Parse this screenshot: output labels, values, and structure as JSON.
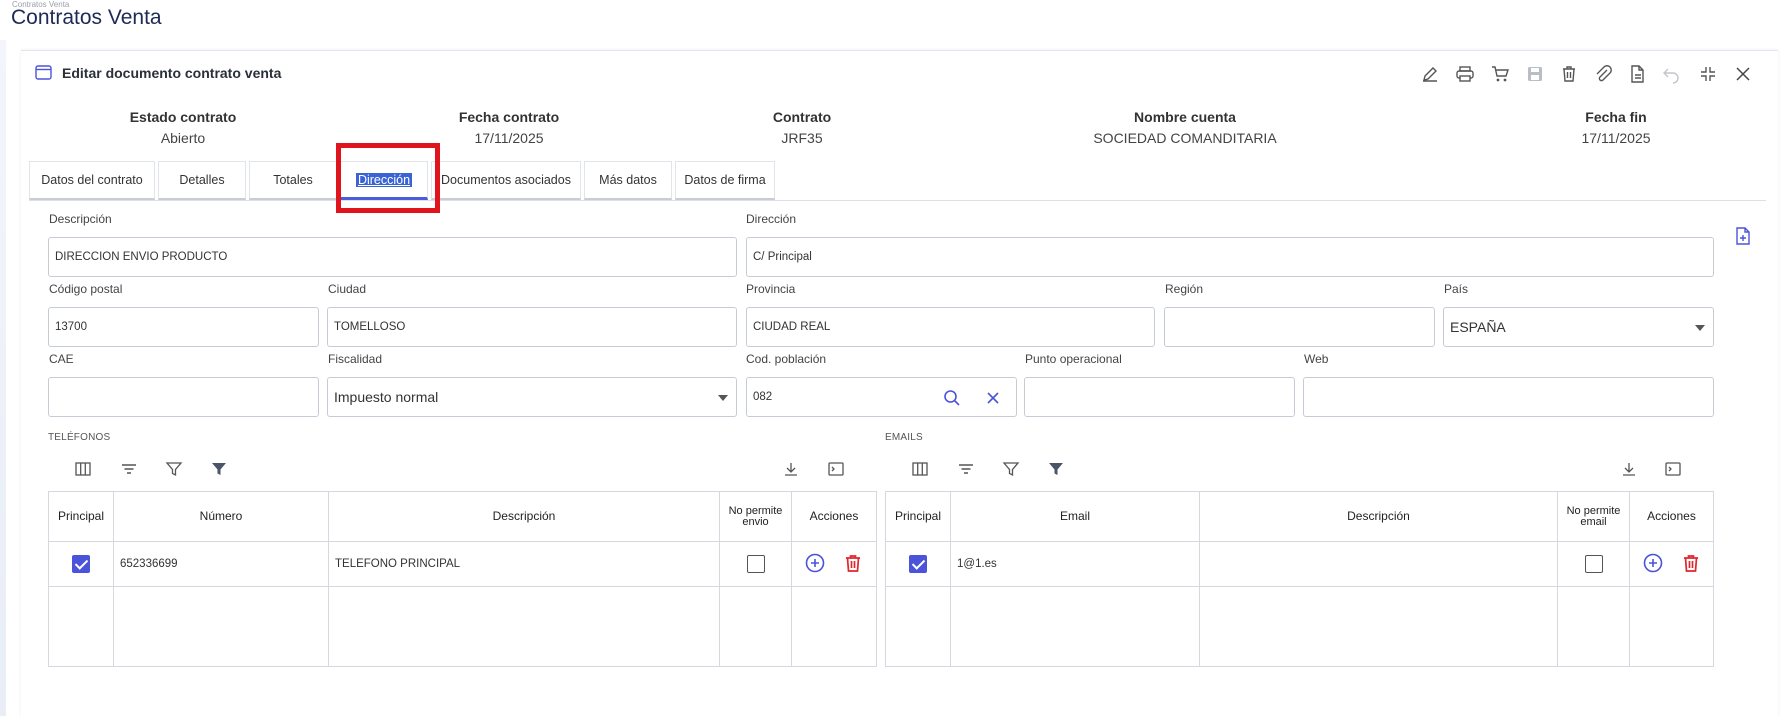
{
  "breadcrumb": "Contratos Venta",
  "app_title": "Contratos Venta",
  "panel": {
    "title": "Editar documento contrato venta",
    "toolbar": [
      "edit-icon",
      "print-icon",
      "cart-icon",
      "save-icon",
      "trash-icon",
      "attach-icon",
      "document-icon",
      "undo-icon",
      "collapse-icon",
      "close-icon"
    ]
  },
  "summary": [
    {
      "label": "Estado contrato",
      "value": "Abierto"
    },
    {
      "label": "Fecha contrato",
      "value": "17/11/2025"
    },
    {
      "label": "Contrato",
      "value": "JRF35"
    },
    {
      "label": "Nombre cuenta",
      "value": "SOCIEDAD COMANDITARIA"
    },
    {
      "label": "Fecha fin",
      "value": "17/11/2025"
    }
  ],
  "tabs": [
    "Datos del contrato",
    "Detalles",
    "Totales",
    "Dirección",
    "Documentos asociados",
    "Más datos",
    "Datos de firma"
  ],
  "active_tab": "Dirección",
  "form": {
    "descripcion": {
      "label": "Descripción",
      "value": "DIRECCION ENVIO PRODUCTO"
    },
    "direccion": {
      "label": "Dirección",
      "value": "C/ Principal"
    },
    "codigo_postal": {
      "label": "Código postal",
      "value": "13700"
    },
    "ciudad": {
      "label": "Ciudad",
      "value": "TOMELLOSO"
    },
    "provincia": {
      "label": "Provincia",
      "value": "CIUDAD REAL"
    },
    "region": {
      "label": "Región",
      "value": ""
    },
    "pais": {
      "label": "País",
      "value": "ESPAÑA"
    },
    "cae": {
      "label": "CAE",
      "value": ""
    },
    "fiscalidad": {
      "label": "Fiscalidad",
      "value": "Impuesto normal"
    },
    "cod_poblacion": {
      "label": "Cod. población",
      "value": "082"
    },
    "punto_operacional": {
      "label": "Punto operacional",
      "value": ""
    },
    "web": {
      "label": "Web",
      "value": ""
    }
  },
  "telefonos": {
    "title": "TELÉFONOS",
    "headers": [
      "Principal",
      "Número",
      "Descripción",
      "No permite envio",
      "Acciones"
    ],
    "rows": [
      {
        "principal": true,
        "numero": "652336699",
        "descripcion": "TELEFONO PRINCIPAL",
        "no_permite": false
      }
    ]
  },
  "emails": {
    "title": "EMAILS",
    "headers": [
      "Principal",
      "Email",
      "Descripción",
      "No permite email",
      "Acciones"
    ],
    "rows": [
      {
        "principal": true,
        "email": "1@1.es",
        "descripcion": "",
        "no_permite": false
      }
    ]
  },
  "colors": {
    "accent": "#4b54d8",
    "highlight": "#e0141c",
    "delete": "#e0262e"
  }
}
